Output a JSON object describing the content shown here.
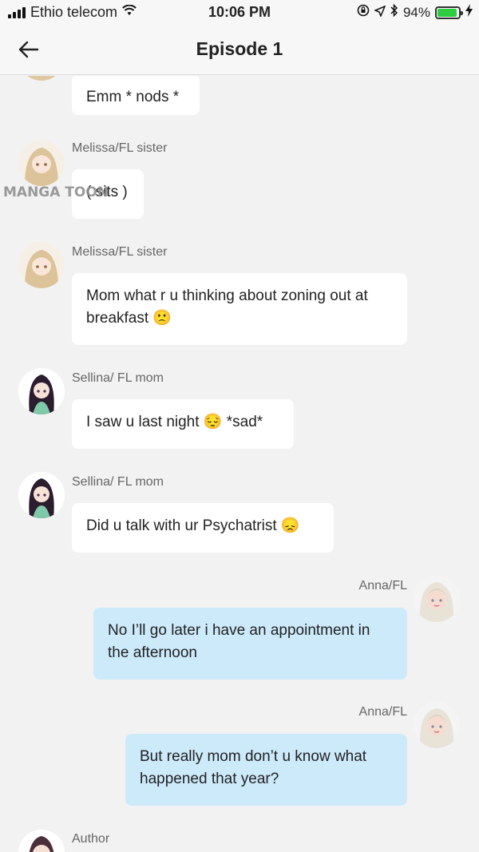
{
  "status_bar": {
    "carrier": "Ethio telecom",
    "time": "10:06 PM",
    "battery_percent": "94%",
    "battery_level": 0.94
  },
  "header": {
    "title": "Episode 1"
  },
  "watermark": "MANGA TOON",
  "messages": [
    {
      "sender": "",
      "text": "Emm * nods *",
      "side": "left"
    },
    {
      "sender": "Melissa/FL sister",
      "text": "( sits )",
      "side": "left"
    },
    {
      "sender": "Melissa/FL sister",
      "text": "Mom what r u thinking about zoning out at breakfast 🙁",
      "side": "left"
    },
    {
      "sender": "Sellina/ FL mom",
      "text": "I saw u last night 😔 *sad*",
      "side": "left"
    },
    {
      "sender": "Sellina/ FL mom",
      "text": "Did u talk with ur Psychatrist 😞",
      "side": "left"
    },
    {
      "sender": "Anna/FL",
      "text": "No I’ll go later i have an appointment in the afternoon",
      "side": "right"
    },
    {
      "sender": "Anna/FL",
      "text": "But really mom don’t u know what happened that year?",
      "side": "right"
    },
    {
      "sender": "Author",
      "text": "",
      "side": "left"
    }
  ]
}
